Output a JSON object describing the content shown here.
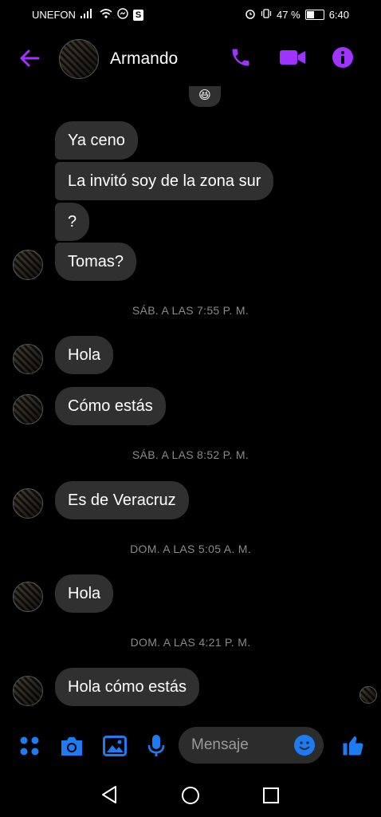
{
  "status_bar": {
    "carrier": "UNEFON",
    "badge": "S",
    "battery": "47 %",
    "time": "6:40"
  },
  "header": {
    "contact_name": "Armando",
    "accent_color": "#a033ff"
  },
  "reaction_emoji": "😆",
  "messages": [
    {
      "type": "bubble",
      "text": "Ya ceno"
    },
    {
      "type": "bubble",
      "text": "La invitó soy de la zona sur"
    },
    {
      "type": "bubble",
      "text": "?"
    },
    {
      "type": "bubble",
      "text": "Tomas?"
    },
    {
      "type": "timestamp",
      "text": "SÁB. A LAS 7:55 P. M."
    },
    {
      "type": "bubble",
      "text": "Hola"
    },
    {
      "type": "bubble",
      "text": "Cómo estás"
    },
    {
      "type": "timestamp",
      "text": "SÁB. A LAS 8:52 P. M."
    },
    {
      "type": "bubble",
      "text": "Es de Veracruz"
    },
    {
      "type": "timestamp",
      "text": "DOM. A LAS 5:05 A. M."
    },
    {
      "type": "bubble",
      "text": "Hola"
    },
    {
      "type": "timestamp",
      "text": "DOM. A LAS 4:21 P. M."
    },
    {
      "type": "bubble",
      "text": "Hola cómo estás"
    }
  ],
  "composer": {
    "placeholder": "Mensaje",
    "icon_color": "#1e7cf2"
  }
}
